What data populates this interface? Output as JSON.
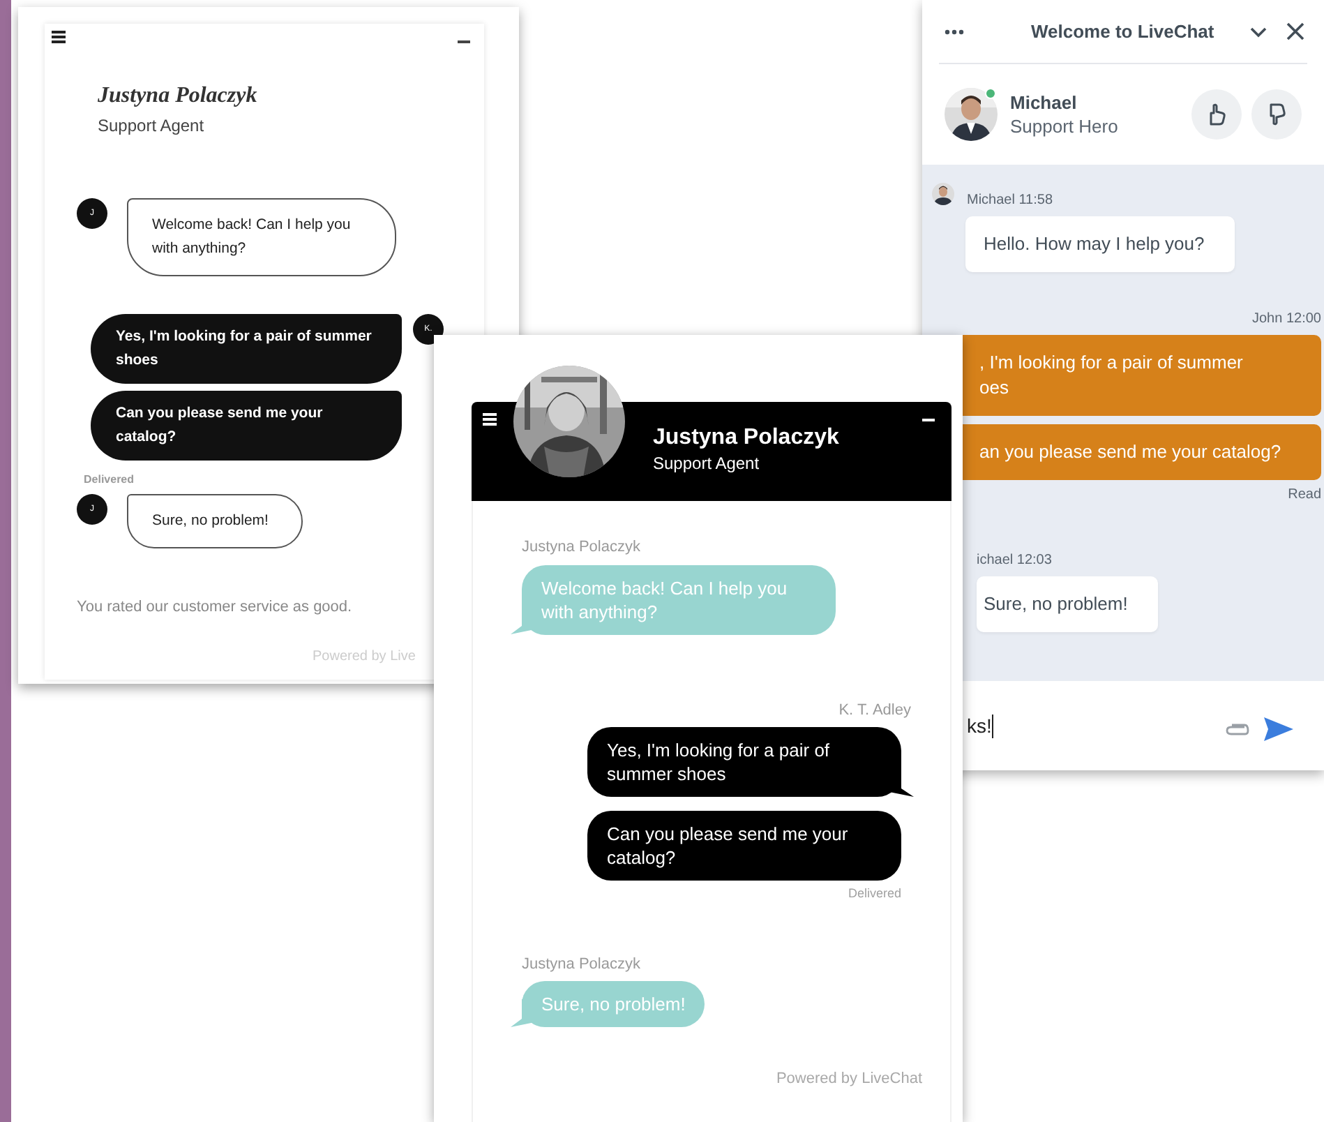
{
  "left_widget": {
    "agent_name": "Justyna Polaczyk",
    "agent_role": "Support Agent",
    "messages": [
      {
        "kind": "agent",
        "avatar": "J",
        "text": "Welcome back! Can I help you with anything?"
      },
      {
        "kind": "visitor",
        "avatar": "K.",
        "text": "Yes, I'm looking for a pair of summer shoes"
      },
      {
        "kind": "visitor",
        "text": "Can you please send me your catalog?"
      },
      {
        "kind": "status",
        "text": "Delivered"
      },
      {
        "kind": "agent",
        "avatar": "J",
        "text": "Sure, no problem!"
      }
    ],
    "rating_note": "You rated our customer service as good.",
    "footer": "Powered by Live"
  },
  "center_widget": {
    "agent_name": "Justyna Polaczyk",
    "agent_role": "Support Agent",
    "groups": [
      {
        "kind": "agent",
        "author": "Justyna Polaczyk",
        "messages": [
          "Welcome back! Can I help you with anything?"
        ]
      },
      {
        "kind": "visitor",
        "author": "K. T. Adley",
        "messages": [
          "Yes, I'm looking for a pair of summer shoes",
          "Can you please send me your catalog?"
        ],
        "status": "Delivered"
      },
      {
        "kind": "agent",
        "author": "Justyna Polaczyk",
        "messages": [
          "Sure, no problem!"
        ]
      }
    ],
    "footer": "Powered by LiveChat"
  },
  "right_widget": {
    "title": "Welcome to LiveChat",
    "agent_name": "Michael",
    "agent_role": "Support Hero",
    "online": true,
    "groups": [
      {
        "kind": "agent",
        "author": "Michael 11:58",
        "avatar": true,
        "messages": [
          "Hello. How may I help you?"
        ]
      },
      {
        "kind": "visitor",
        "author": "John 12:00",
        "messages": [
          ", I'm looking for a pair of summer\noes",
          "an you please send me your catalog?"
        ],
        "status": "Read"
      },
      {
        "kind": "agent",
        "author": "ichael 12:03",
        "messages": [
          "Sure, no problem!"
        ]
      }
    ],
    "input": {
      "value": "ks!"
    }
  }
}
